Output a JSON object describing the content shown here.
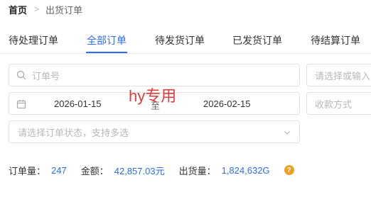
{
  "breadcrumb": {
    "home": "首页",
    "separator": ">",
    "current": "出货订单"
  },
  "tabs": [
    {
      "label": "待处理订单"
    },
    {
      "label": "全部订单"
    },
    {
      "label": "待发货订单"
    },
    {
      "label": "已发货订单"
    },
    {
      "label": "待结算订单"
    }
  ],
  "active_tab": "全部订单",
  "filters": {
    "order_no": {
      "placeholder": "订单号"
    },
    "customer": {
      "placeholder": "请选择或输入"
    },
    "date_range": {
      "start": "2026-01-15",
      "separator": "至",
      "end": "2026-02-15"
    },
    "payment": {
      "placeholder": "收款方式"
    },
    "status": {
      "placeholder": "请选择订单状态，支持多选"
    }
  },
  "watermark": "hy专用",
  "summary": {
    "order_count_label": "订单量：",
    "order_count": "247",
    "amount_label": "金额：",
    "amount": "42,857.03元",
    "volume_label": "出货量：",
    "volume": "1,824,632G",
    "help_icon_text": "?"
  },
  "colors": {
    "accent": "#2c6cf6",
    "watermark": "#e03c3c",
    "help_badge": "#f0a020"
  },
  "icons": [
    "search-icon",
    "calendar-icon",
    "chevron-down-icon",
    "help-icon"
  ]
}
